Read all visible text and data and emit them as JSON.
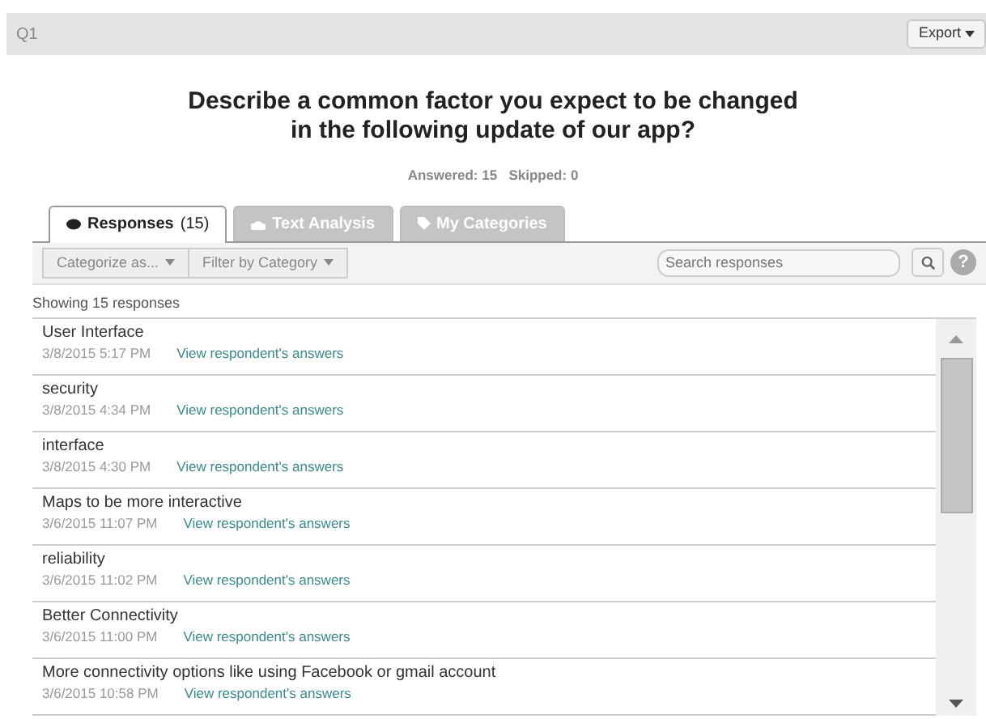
{
  "header": {
    "label": "Q1",
    "export_button": "Export"
  },
  "question": "Describe a common factor you expect to be changed in the following update of our app?",
  "stats": {
    "answered": "Answered: 15",
    "skipped": "Skipped: 0"
  },
  "tabs": [
    {
      "label": "Responses",
      "count": "(15)",
      "selected": true
    },
    {
      "label": "Text Analysis",
      "selected": false
    },
    {
      "label": "My Categories",
      "selected": false
    }
  ],
  "toolbar": {
    "categorize": "Categorize as...",
    "filter": "Filter by Category",
    "search_placeholder": "Search responses",
    "help": "?"
  },
  "showing": "Showing 15 responses",
  "responses": [
    {
      "text": "User Interface",
      "time": "3/8/2015 5:17 PM",
      "link": "View respondent's answers"
    },
    {
      "text": "security",
      "time": "3/8/2015 4:34 PM",
      "link": "View respondent's answers"
    },
    {
      "text": "interface",
      "time": "3/8/2015 4:30 PM",
      "link": "View respondent's answers"
    },
    {
      "text": "Maps to be more interactive",
      "time": "3/6/2015 11:07 PM",
      "link": "View respondent's answers"
    },
    {
      "text": "reliability",
      "time": "3/6/2015 11:02 PM",
      "link": "View respondent's answers"
    },
    {
      "text": "Better Connectivity",
      "time": "3/6/2015 11:00 PM",
      "link": "View respondent's answers"
    },
    {
      "text": "More connectivity options like using Facebook or gmail account",
      "time": "3/6/2015 10:58 PM",
      "link": "View respondent's answers"
    }
  ]
}
